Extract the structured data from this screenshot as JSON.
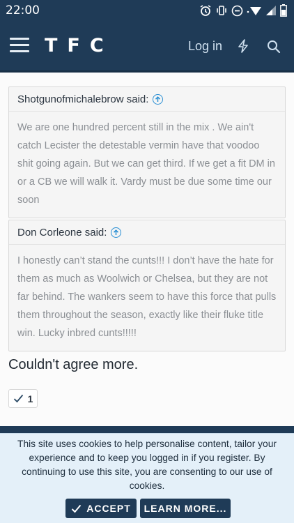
{
  "status_bar": {
    "time": "22:00"
  },
  "header": {
    "logo": "TFC",
    "login_label": "Log in"
  },
  "quotes": [
    {
      "author": "Shotgunofmichalebrow said:",
      "text": "We are one hundred percent still in the mix . We ain't catch Lecister the detestable vermin have that voodoo shit going again. But we can get third. If we get a fit DM in or a CB we will walk it. Vardy must be due some time our soon"
    },
    {
      "author": "Don Corleone said:",
      "text": "I honestly can’t stand the cunts!!! I don’t have the hate for them as much as Woolwich or Chelsea, but they are not far behind. The wankers seem to have this force that pulls them throughout the season, exactly like their fluke title win. Lucky inbred cunts!!!!!"
    }
  ],
  "post": {
    "text": "Couldn't agree more.",
    "like_count": "1"
  },
  "cookie_notice": {
    "text": "This site uses cookies to help personalise content, tailor your experience and to keep you logged in if you register. By continuing to use this site, you are consenting to our use of cookies.",
    "accept_label": "ACCEPT",
    "learn_more_label": "LEARN MORE..."
  }
}
